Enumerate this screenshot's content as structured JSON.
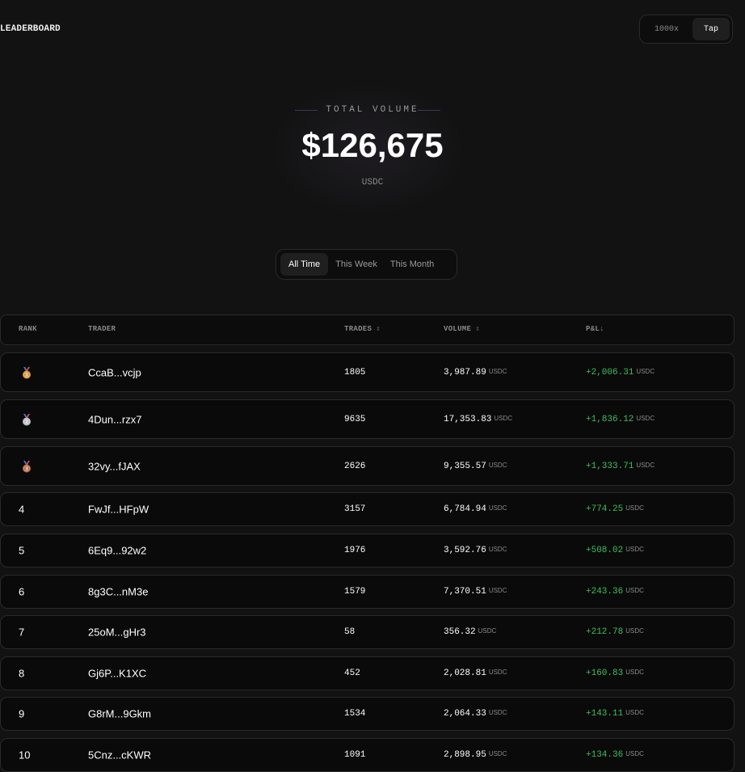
{
  "header": {
    "brand": "LEADERBOARD",
    "modes": [
      "1000x",
      "Tap"
    ],
    "active_mode": "Tap"
  },
  "hero": {
    "label": "TOTAL VOLUME",
    "value": "$126,675",
    "unit": "USDC"
  },
  "period_tabs": {
    "items": [
      "All Time",
      "This Week",
      "This Month"
    ],
    "active": "All Time"
  },
  "table": {
    "columns": {
      "rank": "RANK",
      "trader": "TRADER",
      "trades": "TRADES",
      "volume": "VOLUME",
      "pnl": "P&L↓"
    },
    "currency": "USDC",
    "medal_colors": {
      "gold": "#d4943a",
      "silver": "#b8b8c8",
      "bronze": "#b06a45"
    },
    "rows": [
      {
        "rank": "1",
        "medal": "gold",
        "trader": "CcaB...vcjp",
        "trades": "1805",
        "volume": "3,987.89",
        "pnl": "+2,006.31"
      },
      {
        "rank": "2",
        "medal": "silver",
        "trader": "4Dun...rzx7",
        "trades": "9635",
        "volume": "17,353.83",
        "pnl": "+1,836.12"
      },
      {
        "rank": "3",
        "medal": "bronze",
        "trader": "32vy...fJAX",
        "trades": "2626",
        "volume": "9,355.57",
        "pnl": "+1,333.71"
      },
      {
        "rank": "4",
        "trader": "FwJf...HFpW",
        "trades": "3157",
        "volume": "6,784.94",
        "pnl": "+774.25"
      },
      {
        "rank": "5",
        "trader": "6Eq9...92w2",
        "trades": "1976",
        "volume": "3,592.76",
        "pnl": "+508.02"
      },
      {
        "rank": "6",
        "trader": "8g3C...nM3e",
        "trades": "1579",
        "volume": "7,370.51",
        "pnl": "+243.36"
      },
      {
        "rank": "7",
        "trader": "25oM...gHr3",
        "trades": "58",
        "volume": "356.32",
        "pnl": "+212.78"
      },
      {
        "rank": "8",
        "trader": "Gj6P...K1XC",
        "trades": "452",
        "volume": "2,028.81",
        "pnl": "+160.83"
      },
      {
        "rank": "9",
        "trader": "G8rM...9Gkm",
        "trades": "1534",
        "volume": "2,064.33",
        "pnl": "+143.11"
      },
      {
        "rank": "10",
        "trader": "5Cnz...cKWR",
        "trades": "1091",
        "volume": "2,898.95",
        "pnl": "+134.36"
      }
    ]
  }
}
